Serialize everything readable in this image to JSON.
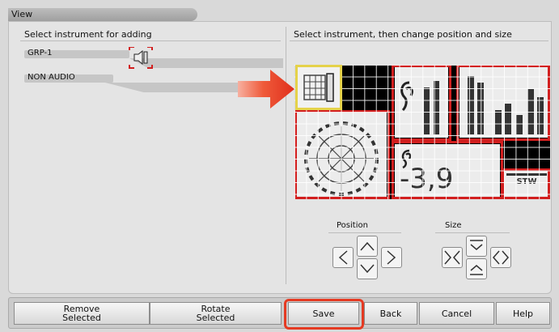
{
  "window": {
    "title": "View"
  },
  "left_panel": {
    "header": "Select instrument for adding",
    "items": [
      {
        "label": "GRP-1",
        "icon": "speaker-icon"
      },
      {
        "label": "NON AUDIO"
      }
    ]
  },
  "right_panel": {
    "header": "Select instrument, then change position and size",
    "position_label": "Position",
    "size_label": "Size",
    "readout": "-3,9",
    "tag": "STW"
  },
  "toolbar": {
    "remove_label_1": "Remove",
    "remove_label_2": "Selected",
    "rotate_label_1": "Rotate",
    "rotate_label_2": "Selected",
    "save_label": "Save",
    "back_label": "Back",
    "cancel_label": "Cancel",
    "help_label": "Help"
  },
  "colors": {
    "accent_red": "#d21f1f",
    "selection_yellow": "#e5d24a",
    "highlight_orange": "#e53a22"
  }
}
